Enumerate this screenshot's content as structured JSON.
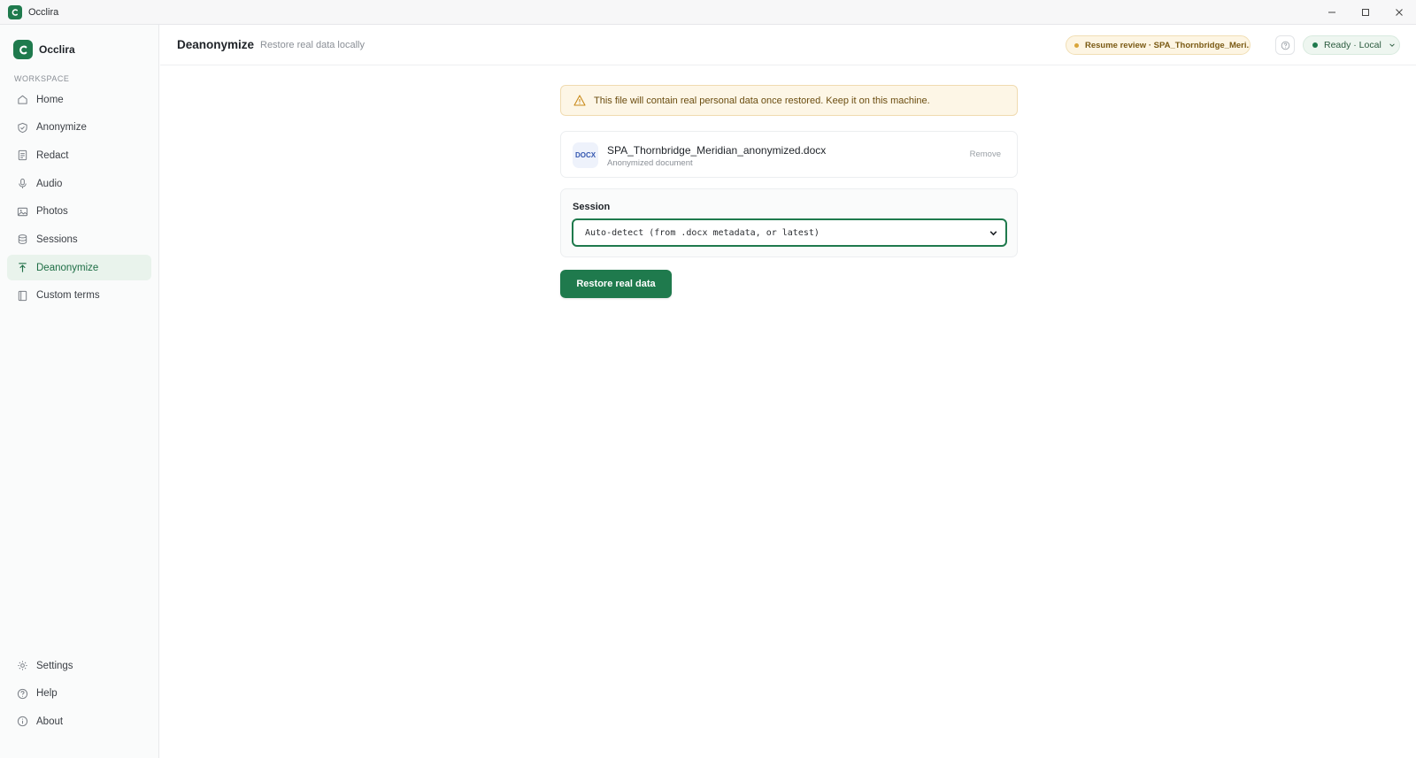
{
  "window": {
    "title": "Occlira",
    "controls": [
      "minimize-icon",
      "maximize-icon",
      "close-icon"
    ]
  },
  "sidebar": {
    "brand": "Occlira",
    "section_label": "WORKSPACE",
    "items": [
      {
        "label": "Home",
        "icon": "home-icon",
        "active": false
      },
      {
        "label": "Anonymize",
        "icon": "shield-icon",
        "active": false
      },
      {
        "label": "Redact",
        "icon": "document-icon",
        "active": false
      },
      {
        "label": "Audio",
        "icon": "microphone-icon",
        "active": false
      },
      {
        "label": "Photos",
        "icon": "image-icon",
        "active": false
      },
      {
        "label": "Sessions",
        "icon": "database-icon",
        "active": false
      },
      {
        "label": "Deanonymize",
        "icon": "upload-arrow-icon",
        "active": true
      },
      {
        "label": "Custom terms",
        "icon": "book-icon",
        "active": false
      }
    ],
    "bottom_items": [
      {
        "label": "Settings",
        "icon": "gear-icon"
      },
      {
        "label": "Help",
        "icon": "help-icon"
      },
      {
        "label": "About",
        "icon": "info-icon"
      }
    ]
  },
  "header": {
    "title": "Deanonymize",
    "subtitle": "Restore real data locally",
    "resume_label": "Resume review · SPA_Thornbridge_Meri...",
    "status_label": "Ready · Local"
  },
  "main": {
    "warning_text": "This file will contain real personal data once restored. Keep it on this machine.",
    "file": {
      "badge": "DOCX",
      "name": "SPA_Thornbridge_Meridian_anonymized.docx",
      "type_label": "Anonymized document",
      "remove_label": "Remove"
    },
    "session": {
      "label": "Session",
      "selected": "Auto-detect (from .docx metadata, or latest)"
    },
    "restore_button": "Restore real data"
  },
  "colors": {
    "accent": "#1f7a4d",
    "active_nav_bg": "#e9f3ec",
    "warning_bg": "#fdf6e6",
    "warning_text": "#6b4d10",
    "resume_dot": "#d9a53a"
  }
}
